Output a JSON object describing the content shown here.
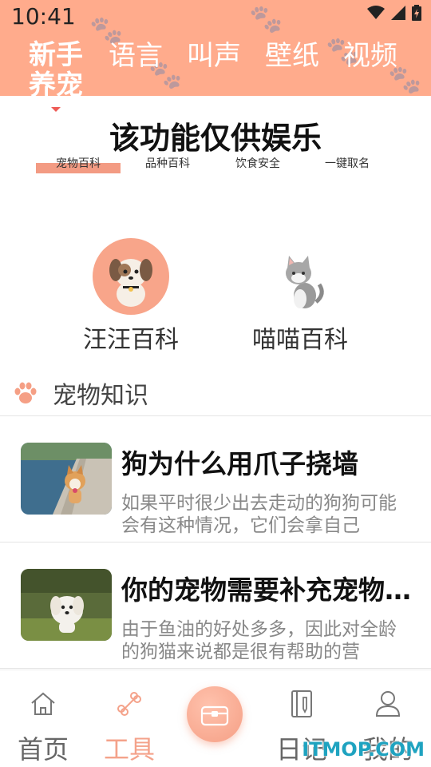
{
  "status_bar": {
    "time": "10:41"
  },
  "category_tabs": [
    {
      "label": "新手养宠",
      "active": true
    },
    {
      "label": "语言",
      "active": false
    },
    {
      "label": "叫声",
      "active": false
    },
    {
      "label": "壁纸",
      "active": false
    },
    {
      "label": "视频",
      "active": false
    }
  ],
  "notice": "该功能仅供娱乐",
  "sub_tabs": [
    {
      "label": "宠物百科",
      "active": true
    },
    {
      "label": "品种百科",
      "active": false
    },
    {
      "label": "饮食安全",
      "active": false
    },
    {
      "label": "一键取名",
      "active": false
    }
  ],
  "wiki_entries": [
    {
      "label": "汪汪百科",
      "icon": "dog-icon"
    },
    {
      "label": "喵喵百科",
      "icon": "cat-icon"
    }
  ],
  "knowledge_section": {
    "title": "宠物知识",
    "icon": "paw-icon"
  },
  "articles": [
    {
      "title": "狗为什么用爪子挠墙",
      "desc": "如果平时很少出去走动的狗狗可能会有这种情况，它们会拿自己"
    },
    {
      "title": "你的宠物需要补充宠物…",
      "desc": "由于鱼油的好处多多，因此对全龄的狗猫来说都是很有帮助的营"
    }
  ],
  "bottom_nav": [
    {
      "label": "首页",
      "icon": "home-icon",
      "active": false
    },
    {
      "label": "工具",
      "icon": "bone-icon",
      "active": true
    },
    {
      "label": "日记",
      "icon": "diary-icon",
      "active": false
    },
    {
      "label": "我的",
      "icon": "profile-icon",
      "active": false
    }
  ],
  "center_button": {
    "icon": "treasure-chest-icon"
  },
  "watermark": "ITMOP.COM",
  "colors": {
    "accent": "#ffab8c",
    "active_tab": "#f4a28a",
    "indicator": "#f39b83"
  }
}
